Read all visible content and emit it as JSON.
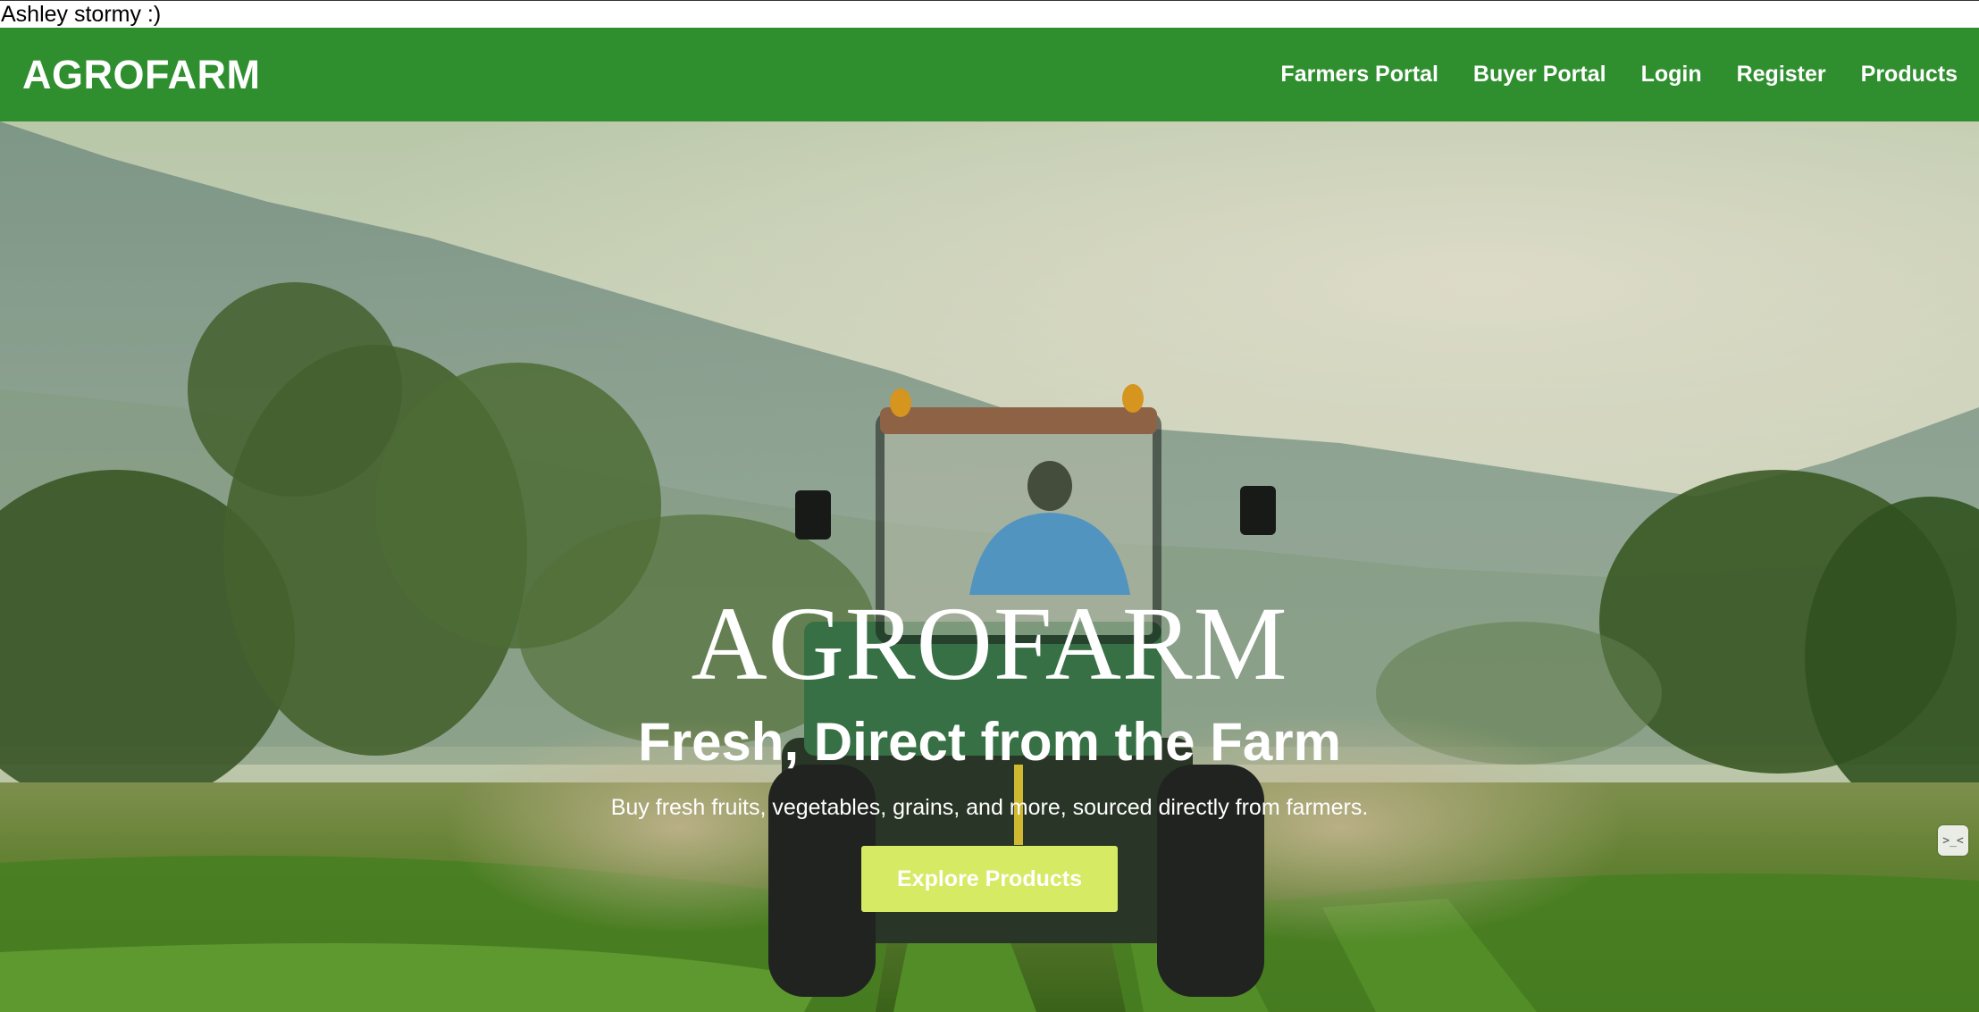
{
  "top_text": "Ashley stormy :)",
  "navbar": {
    "brand": "AGROFARM",
    "links": [
      {
        "label": "Farmers Portal"
      },
      {
        "label": "Buyer Portal"
      },
      {
        "label": "Login"
      },
      {
        "label": "Register"
      },
      {
        "label": "Products"
      }
    ],
    "background_color": "#2f8f2f"
  },
  "hero": {
    "title": "AGROFARM",
    "subtitle": "Fresh, Direct from the Farm",
    "description": "Buy fresh fruits, vegetables, grains, and more, sourced directly from farmers.",
    "button_label": "Explore Products",
    "button_color": "#d6ea63",
    "background_image": "farm-field-tractor-photo"
  },
  "floating_widget": {
    "icon": "assistant-icon",
    "glyph": ">_<"
  }
}
